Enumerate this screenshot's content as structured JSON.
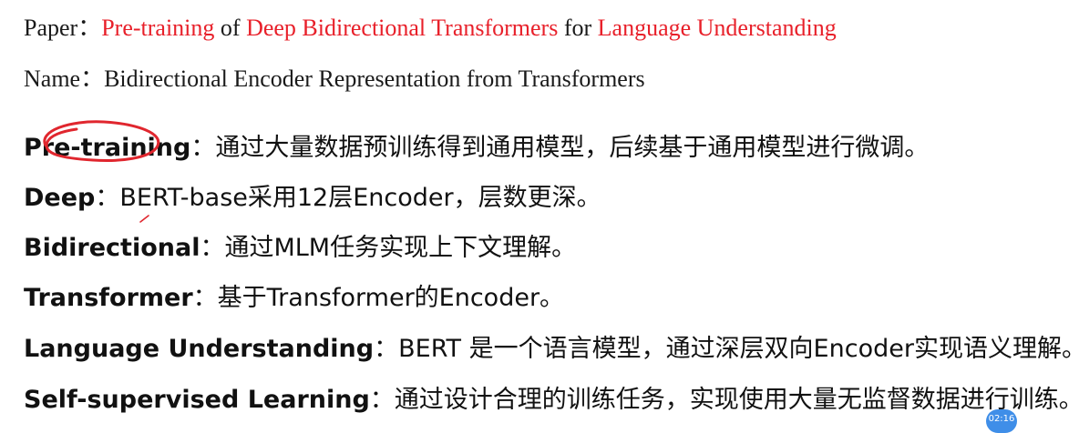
{
  "header": {
    "paper_label": "Paper：",
    "paper_parts": [
      {
        "text": "Pre-training",
        "red": true
      },
      {
        "text": " of ",
        "red": false
      },
      {
        "text": "Deep Bidirectional Transformers",
        "red": true
      },
      {
        "text": " for ",
        "red": false
      },
      {
        "text": "Language Understanding",
        "red": true
      }
    ],
    "name_label": "Name：",
    "name_value": "Bidirectional Encoder Representation from Transformers"
  },
  "terms": [
    {
      "term": "Pre-training",
      "colon": "：",
      "desc": "通过大量数据预训练得到通用模型，后续基于通用模型进行微调。"
    },
    {
      "term": "Deep",
      "colon": "：",
      "desc": "BERT-base采用12层Encoder，层数更深。"
    },
    {
      "term": "Bidirectional",
      "colon": "：",
      "desc": "通过MLM任务实现上下文理解。"
    },
    {
      "term": "Transformer",
      "colon": "：",
      "desc": "基于Transformer的Encoder。"
    },
    {
      "term": "Language Understanding",
      "colon": "：",
      "desc": "BERT 是一个语言模型，通过深层双向Encoder实现语义理解。"
    },
    {
      "term": "Self-supervised Learning",
      "colon": "：",
      "desc": "通过设计合理的训练任务，实现使用大量无监督数据进行训练。"
    }
  ],
  "timer": "02:16",
  "colors": {
    "highlight_red": "#e8202a",
    "ink_red": "#e0262e",
    "badge_blue": "#3f8ee8"
  }
}
